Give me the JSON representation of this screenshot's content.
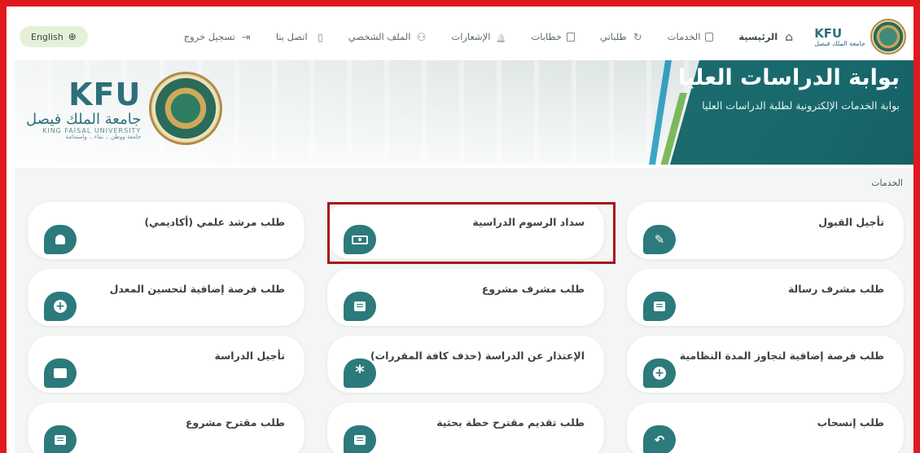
{
  "nav": {
    "logo_text": "KFU",
    "logo_arabic": "جامعة الملك فيصل",
    "items": [
      {
        "label": "الرئيسية",
        "icon": "home-icon"
      },
      {
        "label": "الخدمات",
        "icon": "services-icon"
      },
      {
        "label": "طلباتي",
        "icon": "requests-icon"
      },
      {
        "label": "خطابات",
        "icon": "letters-icon"
      },
      {
        "label": "الإشعارات",
        "icon": "bell-icon"
      },
      {
        "label": "الملف الشخصي",
        "icon": "user-icon"
      },
      {
        "label": "اتصل بنا",
        "icon": "phone-icon"
      },
      {
        "label": "تسجيل خروج",
        "icon": "logout-icon"
      }
    ],
    "language_label": "English"
  },
  "banner": {
    "title": "بوابة الدراسات العليا",
    "subtitle": "بوابة الخدمات الإلكترونية لطلبة الدراسات العليا",
    "logo_text": "KFU",
    "logo_arabic": "جامعة الملك فيصل",
    "logo_english": "KING FAISAL UNIVERSITY",
    "logo_slogan": "جامعة ووطن .. نماء .. واستدامة"
  },
  "services": {
    "section_title": "الخدمات",
    "cards": [
      {
        "label": "تأجيل القبول",
        "icon": "edit-icon"
      },
      {
        "label": "سداد الرسوم الدراسية",
        "icon": "cash-icon"
      },
      {
        "label": "طلب مرشد علمي (أكاديمي)",
        "icon": "user-icon"
      },
      {
        "label": "طلب مشرف رسالة",
        "icon": "document-icon"
      },
      {
        "label": "طلب مشرف مشروع",
        "icon": "document-icon"
      },
      {
        "label": "طلب فرصة إضافية لتحسين المعدل",
        "icon": "plus-icon"
      },
      {
        "label": "طلب فرصة إضافية لتجاوز المدة النظامية",
        "icon": "plus-icon"
      },
      {
        "label": "الإعتذار عن الدراسة (حذف كافة المقررات)",
        "icon": "asterisk-icon"
      },
      {
        "label": "تأجيل الدراسة",
        "icon": "folder-icon"
      },
      {
        "label": "طلب إنسحاب",
        "icon": "reply-icon"
      },
      {
        "label": "طلب تقديم مقترح خطة بحثية",
        "icon": "document-icon"
      },
      {
        "label": "طلب مقترح مشروع",
        "icon": "document-icon"
      }
    ]
  },
  "colors": {
    "accent": "#2c7a7b",
    "banner_teal": "#1c6b6e",
    "frame_red": "#e0191f",
    "highlight_red": "#a8151b"
  }
}
